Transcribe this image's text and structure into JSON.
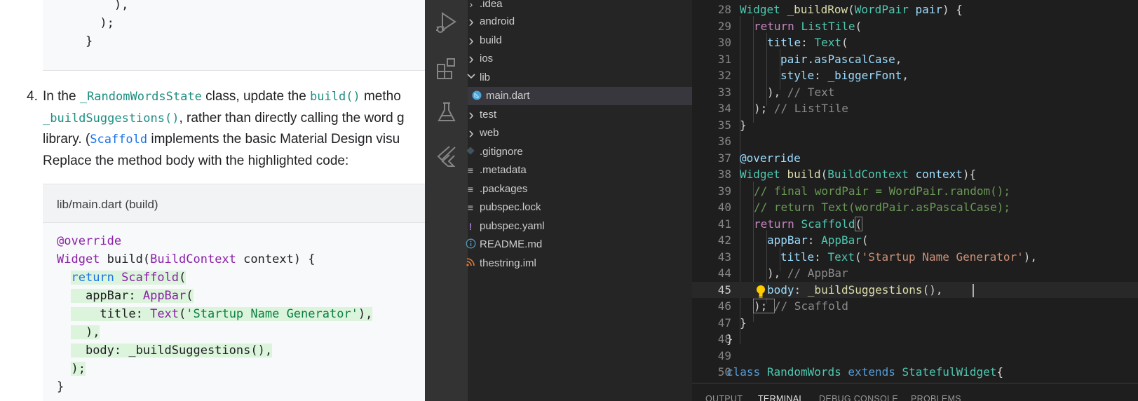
{
  "doc": {
    "top_code": [
      "        ),",
      "      );",
      "    }"
    ],
    "step": {
      "number": "4.",
      "line1": {
        "t1": "In the ",
        "c1": "_RandomWordsState",
        "t2": " class, update the ",
        "c2": "build()",
        "t3": " metho"
      },
      "line2": {
        "c1": "_buildSuggestions()",
        "t1": ", rather than directly calling the word g"
      },
      "line3": {
        "t1": "library. (",
        "c1": "Scaffold",
        "t2": " implements the basic Material Design visu"
      },
      "line4": "Replace the method body with the highlighted code:"
    },
    "code_header": "lib/main.dart (build)",
    "code": {
      "l1": "@override",
      "l2": {
        "w": "Widget",
        "a": " build(",
        "b": "BuildContext",
        "c": " context) {"
      },
      "l3": {
        "pre": "  ",
        "a": "return",
        "b": " ",
        "c": "Scaffold",
        "d": "("
      },
      "l4": {
        "pre": "  ",
        "a": "  appBar: ",
        "b": "AppBar",
        "c": "("
      },
      "l5": {
        "pre": "  ",
        "a": "    title: ",
        "b": "Text",
        "c": "(",
        "d": "'Startup Name Generator'",
        "e": "),"
      },
      "l6": {
        "pre": "  ",
        "a": "  ),"
      },
      "l7": {
        "pre": "  ",
        "a": "  body: _buildSuggestions(),"
      },
      "l8": {
        "pre": "  ",
        "a": ");"
      },
      "l9": "}"
    }
  },
  "explorer": {
    "items": [
      {
        "label": ".idea",
        "kind": "folder-closed"
      },
      {
        "label": "android",
        "kind": "folder-closed"
      },
      {
        "label": "build",
        "kind": "folder-closed"
      },
      {
        "label": "ios",
        "kind": "folder-closed"
      },
      {
        "label": "lib",
        "kind": "folder-open"
      },
      {
        "label": "main.dart",
        "kind": "dart-file"
      },
      {
        "label": "test",
        "kind": "folder-closed"
      },
      {
        "label": "web",
        "kind": "folder-closed"
      },
      {
        "label": ".gitignore",
        "kind": "git-file"
      },
      {
        "label": ".metadata",
        "kind": "text-file"
      },
      {
        "label": ".packages",
        "kind": "text-file"
      },
      {
        "label": "pubspec.lock",
        "kind": "text-file"
      },
      {
        "label": "pubspec.yaml",
        "kind": "yaml-file"
      },
      {
        "label": "README.md",
        "kind": "info-file"
      },
      {
        "label": "thestring.iml",
        "kind": "rss-file"
      }
    ]
  },
  "editor": {
    "lines": {
      "n28": "28",
      "n29": "29",
      "n30": "30",
      "n31": "31",
      "n32": "32",
      "n33": "33",
      "n34": "34",
      "n35": "35",
      "n36": "36",
      "n37": "37",
      "n38": "38",
      "n39": "39",
      "n40": "40",
      "n41": "41",
      "n42": "42",
      "n43": "43",
      "n44": "44",
      "n45": "45",
      "n46": "46",
      "n47": "47",
      "n48": "48",
      "n49": "49",
      "n50": "50"
    },
    "code": {
      "l28": {
        "a": "Widget",
        "b": " ",
        "c": "_buildRow",
        "d": "(",
        "e": "WordPair",
        "f": " ",
        "g": "pair",
        "h": ") {"
      },
      "l29": {
        "a": "return",
        "b": " ",
        "c": "ListTile",
        "d": "("
      },
      "l30": {
        "a": "title",
        "b": ": ",
        "c": "Text",
        "d": "("
      },
      "l31": {
        "a": "pair",
        "b": ".",
        "c": "asPascalCase",
        "d": ","
      },
      "l32": {
        "a": "style",
        "b": ": ",
        "c": "_biggerFont",
        "d": ","
      },
      "l33": {
        "a": "), ",
        "b": "// Text"
      },
      "l34": {
        "a": "); ",
        "b": "// ListTile"
      },
      "l35": "}",
      "l37": "@override",
      "l38": {
        "a": "Widget",
        "b": " ",
        "c": "build",
        "d": "(",
        "e": "BuildContext",
        "f": " ",
        "g": "context",
        "h": "){"
      },
      "l39": "// final wordPair = WordPair.random();",
      "l40": "// return Text(wordPair.asPascalCase);",
      "l41": {
        "a": "return",
        "b": " ",
        "c": "Scaffold",
        "d": "("
      },
      "l42": {
        "a": "appBar",
        "b": ": ",
        "c": "AppBar",
        "d": "("
      },
      "l43": {
        "a": "title",
        "b": ": ",
        "c": "Text",
        "d": "(",
        "e": "'Startup Name Generator'",
        "f": "),"
      },
      "l44": {
        "a": "), ",
        "b": "// AppBar"
      },
      "l45": {
        "a": "body",
        "b": ": ",
        "c": "_buildSuggestions",
        "d": "(),"
      },
      "l46": {
        "a": "); ",
        "b": "// Scaffold"
      },
      "l47": "}",
      "l48": "}",
      "l50": {
        "a": "class",
        "b": " ",
        "c": "RandomWords",
        "d": " ",
        "e": "extends",
        "f": " ",
        "g": "StatefulWidget",
        "h": "{"
      }
    }
  },
  "panel": {
    "tabs": [
      "OUTPUT",
      "TERMINAL",
      "DEBUG CONSOLE",
      "PROBLEMS"
    ],
    "active_tab": "TERMINAL"
  },
  "colors": {
    "activity_bar": "#333333",
    "sidebar": "#252526",
    "editor_bg": "#1e1e1e",
    "doc_code_bg": "#f8f9fa",
    "highlight": "#dcf4dc"
  }
}
